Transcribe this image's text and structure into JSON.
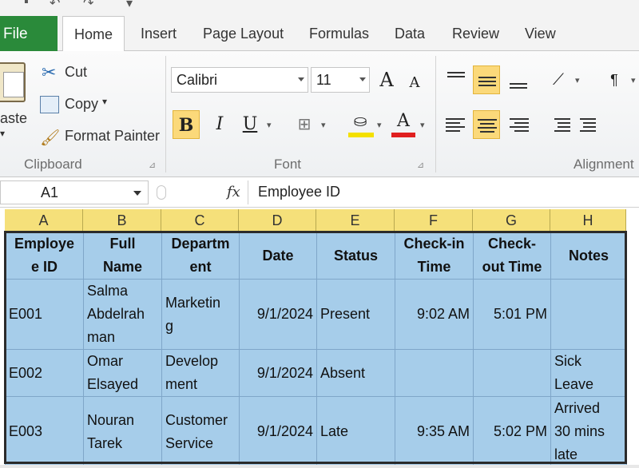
{
  "tabs": {
    "file": "File",
    "items": [
      "Home",
      "Insert",
      "Page Layout",
      "Formulas",
      "Data",
      "Review",
      "View"
    ]
  },
  "clipboard": {
    "paste": "aste",
    "cut": "Cut",
    "copy": "Copy",
    "format_painter": "Format Painter",
    "label": "Clipboard"
  },
  "font": {
    "name": "Calibri",
    "size": "11",
    "bold": "B",
    "italic": "I",
    "underline": "U",
    "grow": "A",
    "shrink": "A",
    "color_letter": "A",
    "label": "Font",
    "highlight_color": "#f4e000",
    "text_color": "#e02020"
  },
  "alignment": {
    "label": "Alignment",
    "pilcrow": "¶"
  },
  "formula_bar": {
    "name_box": "A1",
    "fx": "fx",
    "content": "Employee ID"
  },
  "sheet": {
    "columns": [
      "A",
      "B",
      "C",
      "D",
      "E",
      "F",
      "G",
      "H"
    ],
    "header": [
      [
        "Employe",
        "e ID"
      ],
      [
        "Full",
        "Name"
      ],
      [
        "Departm",
        "ent"
      ],
      [
        "Date"
      ],
      [
        "Status"
      ],
      [
        "Check-in",
        "Time"
      ],
      [
        "Check-",
        "out Time"
      ],
      [
        "Notes"
      ]
    ],
    "rows": [
      [
        [
          "E001"
        ],
        [
          "Salma",
          "Abdelrah",
          "man"
        ],
        [
          "Marketin",
          "g"
        ],
        [
          "9/1/2024"
        ],
        [
          "Present"
        ],
        [
          "9:02 AM"
        ],
        [
          "5:01 PM"
        ],
        [
          ""
        ]
      ],
      [
        [
          "E002"
        ],
        [
          "Omar",
          "Elsayed"
        ],
        [
          "Develop",
          "ment"
        ],
        [
          "9/1/2024"
        ],
        [
          "Absent"
        ],
        [
          ""
        ],
        [
          ""
        ],
        [
          "Sick",
          "Leave"
        ]
      ],
      [
        [
          "E003"
        ],
        [
          "Nouran",
          "Tarek"
        ],
        [
          "Customer",
          "Service"
        ],
        [
          "9/1/2024"
        ],
        [
          "Late"
        ],
        [
          "9:35 AM"
        ],
        [
          "5:02 PM"
        ],
        [
          "Arrived",
          "30 mins",
          "late"
        ]
      ]
    ],
    "fill_color": "#a6cdea",
    "header_color": "#f5e07a"
  }
}
